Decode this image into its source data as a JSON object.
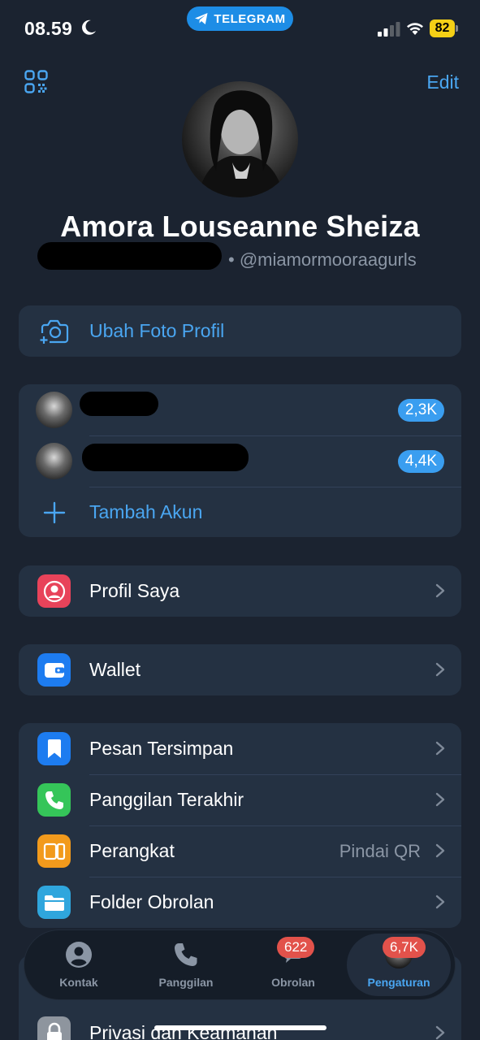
{
  "status": {
    "time": "08.59",
    "app_pill": "TELEGRAM",
    "battery": "82"
  },
  "header": {
    "edit_label": "Edit",
    "profile_name": "Amora Louseanne Sheiza",
    "username": "• @miamormooraagurls"
  },
  "photo_card": {
    "label": "Ubah Foto Profil"
  },
  "accounts": {
    "items": [
      {
        "badge": "2,3K"
      },
      {
        "badge": "4,4K"
      }
    ],
    "add_label": "Tambah Akun"
  },
  "menu": {
    "profil": "Profil Saya",
    "wallet": "Wallet",
    "saved": "Pesan Tersimpan",
    "calls": "Panggilan Terakhir",
    "devices": "Perangkat",
    "devices_value": "Pindai QR",
    "folders": "Folder Obrolan",
    "privacy": "Privasi dan Keamanan"
  },
  "tabs": {
    "contacts": "Kontak",
    "calls": "Panggilan",
    "chats": "Obrolan",
    "chats_badge": "622",
    "settings": "Pengaturan",
    "settings_badge": "6,7K"
  },
  "colors": {
    "accent": "#4aa6f1",
    "background": "#1b2330",
    "card": "#243142",
    "badge_red": "#e2524b"
  }
}
